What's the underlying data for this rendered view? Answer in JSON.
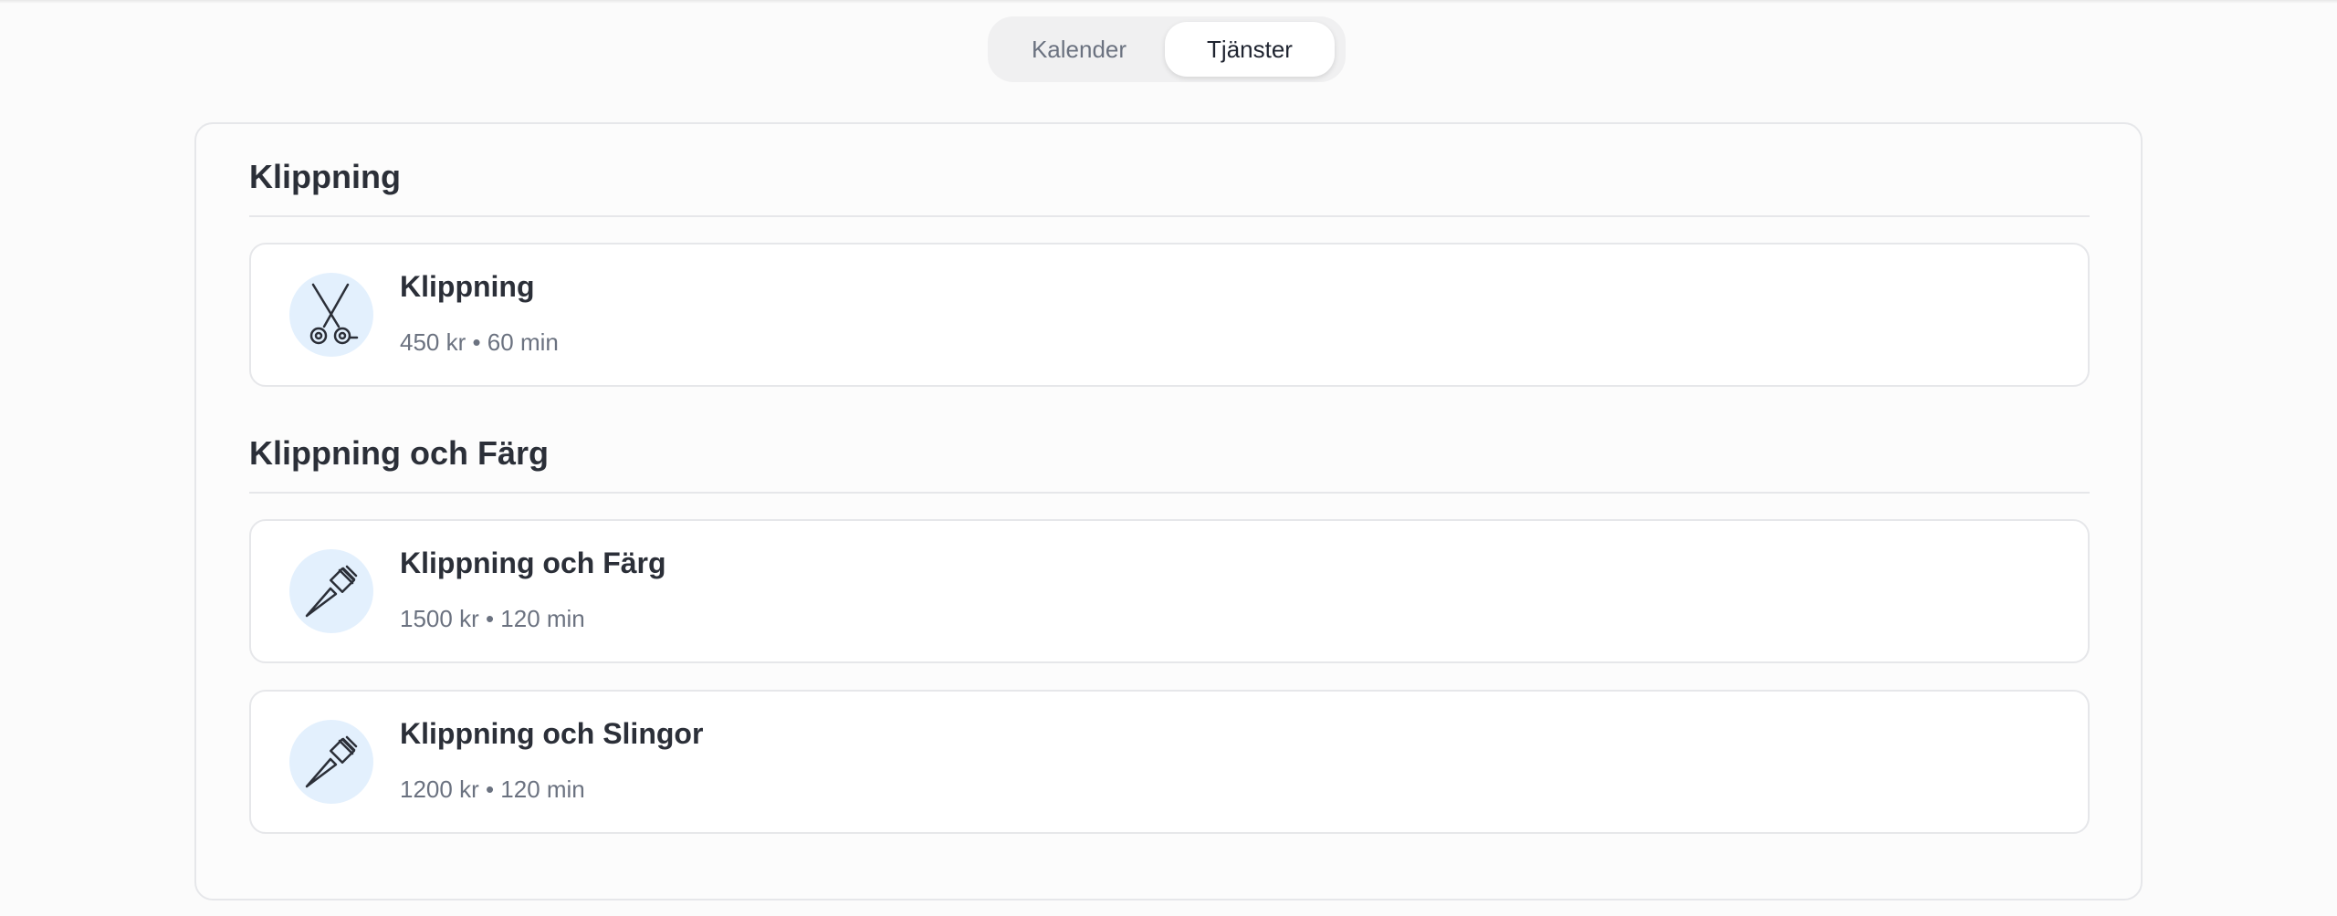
{
  "tabs": [
    {
      "label": "Kalender",
      "active": false
    },
    {
      "label": "Tjänster",
      "active": true
    }
  ],
  "categories": [
    {
      "title": "Klippning",
      "services": [
        {
          "name": "Klippning",
          "price": "450 kr",
          "duration": "60 min",
          "meta": "450 kr • 60 min",
          "icon": "scissors-icon"
        }
      ]
    },
    {
      "title": "Klippning och Färg",
      "services": [
        {
          "name": "Klippning och Färg",
          "price": "1500 kr",
          "duration": "120 min",
          "meta": "1500 kr • 120 min",
          "icon": "hair-dye-brush-icon"
        },
        {
          "name": "Klippning och Slingor",
          "price": "1200 kr",
          "duration": "120 min",
          "meta": "1200 kr • 120 min",
          "icon": "hair-dye-brush-icon"
        }
      ]
    }
  ],
  "colors": {
    "background": "#fbfbfb",
    "icon_circle": "#e3f0fd",
    "border": "#e6e7ea",
    "text_primary": "#2b2f38",
    "text_secondary": "#6b7280"
  }
}
